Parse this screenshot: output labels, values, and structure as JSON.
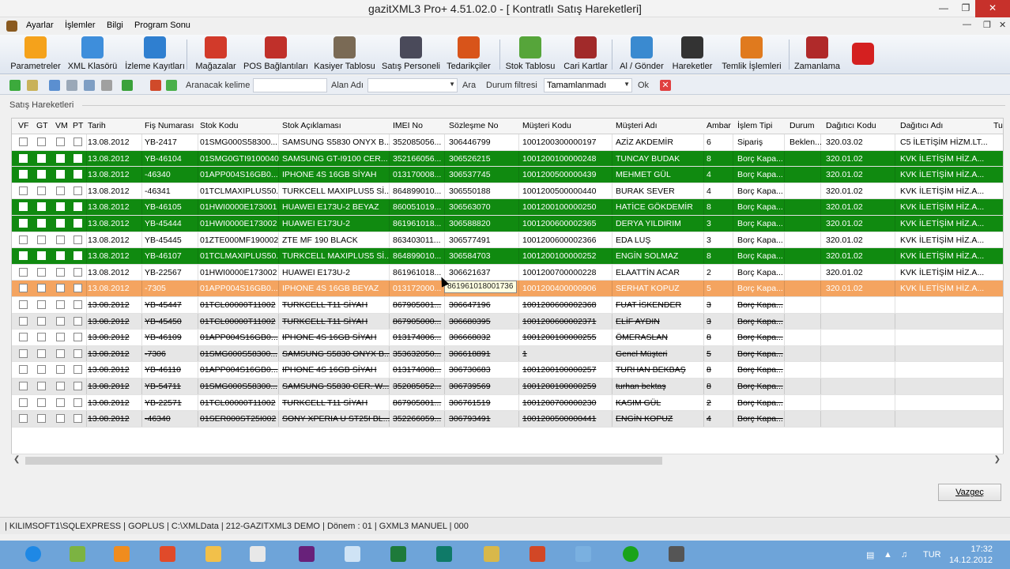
{
  "window": {
    "title": "gazitXML3 Pro+ 4.51.02.0 - [ Kontratlı Satış Hareketleri]"
  },
  "menu": [
    "Ayarlar",
    "İşlemler",
    "Bilgi",
    "Program Sonu"
  ],
  "ribbon": [
    {
      "label": "Parametreler",
      "icon": "gear-icon",
      "color": "#f5a21b"
    },
    {
      "label": "XML Klasörü",
      "icon": "folder-add-icon",
      "color": "#3e8edb"
    },
    {
      "label": "İzleme Kayıtları",
      "icon": "list-icon",
      "color": "#2f7fd0"
    },
    {
      "label": "Mağazalar",
      "icon": "store-icon",
      "color": "#d23a2a"
    },
    {
      "label": "POS Bağlantıları",
      "icon": "bank-icon",
      "color": "#c0302a"
    },
    {
      "label": "Kasiyer Tablosu",
      "icon": "cash-register-icon",
      "color": "#7a6a55"
    },
    {
      "label": "Satış Personeli",
      "icon": "people-icon",
      "color": "#4a4a5a"
    },
    {
      "label": "Tedarikçiler",
      "icon": "supplier-icon",
      "color": "#d8541a"
    },
    {
      "label": "Stok Tablosu",
      "icon": "stock-icon",
      "color": "#56a53a"
    },
    {
      "label": "Cari Kartlar",
      "icon": "cards-icon",
      "color": "#a12a2a"
    },
    {
      "label": "Al / Gönder",
      "icon": "transfer-icon",
      "color": "#3a8ad0"
    },
    {
      "label": "Hareketler",
      "icon": "movements-icon",
      "color": "#333333"
    },
    {
      "label": "Temlik İşlemleri",
      "icon": "assignment-icon",
      "color": "#e07a1e"
    },
    {
      "label": "Zamanlama",
      "icon": "schedule-icon",
      "color": "#b02a2a"
    },
    {
      "label": "",
      "icon": "power-icon",
      "color": "#d42020"
    }
  ],
  "toolbar": {
    "search_label": "Aranacak kelime",
    "search_value": "",
    "field_label": "Alan Adı",
    "field_value": "",
    "search_button": "Ara",
    "status_filter_label": "Durum filtresi",
    "status_filter_value": "Tamamlanmadı",
    "ok_button": "Ok"
  },
  "group_title": "Satış Hareketleri",
  "grid": {
    "columns": [
      "VF",
      "GT",
      "VM",
      "PT",
      "Tarih",
      "Fiş Numarası",
      "Stok Kodu",
      "Stok Açıklaması",
      "IMEI No",
      "Sözleşme No",
      "Müşteri Kodu",
      "Müşteri Adı",
      "Ambar",
      "İşlem Tipi",
      "Durum",
      "Dağıtıcı Kodu",
      "Dağıtıcı Adı",
      "Tu"
    ],
    "rows": [
      {
        "style": "white",
        "cells": [
          "13.08.2012",
          "YB-2417",
          "01SMG000S58300...",
          "SAMSUNG S5830 ONYX B...",
          "352085056...",
          "306446799",
          "1001200300000197",
          "AZİZ AKDEMİR",
          "6",
          "Sipariş",
          "Beklen...",
          "320.03.02",
          "C5 İLETİŞİM HİZM.LT..."
        ]
      },
      {
        "style": "green",
        "cells": [
          "13.08.2012",
          "YB-46104",
          "01SMG0GTI9100040",
          "SAMSUNG GT-I9100 CER...",
          "352166056...",
          "306526215",
          "1001200100000248",
          "TUNCAY BUDAK",
          "8",
          "Borç Kapa...",
          "",
          "320.01.02",
          "KVK İLETİŞİM HİZ.A..."
        ]
      },
      {
        "style": "green",
        "cells": [
          "13.08.2012",
          "-46340",
          "01APP004S16GB0...",
          "IPHONE 4S 16GB SİYAH",
          "013170008...",
          "306537745",
          "1001200500000439",
          "MEHMET GÜL",
          "4",
          "Borç Kapa...",
          "",
          "320.01.02",
          "KVK İLETİŞİM HİZ.A..."
        ]
      },
      {
        "style": "white",
        "cells": [
          "13.08.2012",
          "-46341",
          "01TCLMAXIPLUS50...",
          "TURKCELL MAXIPLUS5 Sİ...",
          "864899010...",
          "306550188",
          "1001200500000440",
          "BURAK SEVER",
          "4",
          "Borç Kapa...",
          "",
          "320.01.02",
          "KVK İLETİŞİM HİZ.A..."
        ]
      },
      {
        "style": "green",
        "cells": [
          "13.08.2012",
          "YB-46105",
          "01HWI0000E173001",
          "HUAWEI E173U-2 BEYAZ",
          "860051019...",
          "306563070",
          "1001200100000250",
          "HATİCE GÖKDEMİR",
          "8",
          "Borç Kapa...",
          "",
          "320.01.02",
          "KVK İLETİŞİM HİZ.A..."
        ]
      },
      {
        "style": "green",
        "cells": [
          "13.08.2012",
          "YB-45444",
          "01HWI0000E173002",
          "HUAWEI E173U-2",
          "861961018...",
          "306588820",
          "1001200600002365",
          "DERYA YILDIRIM",
          "3",
          "Borç Kapa...",
          "",
          "320.01.02",
          "KVK İLETİŞİM HİZ.A..."
        ]
      },
      {
        "style": "white",
        "cells": [
          "13.08.2012",
          "YB-45445",
          "01ZTE000MF190002",
          "ZTE MF 190 BLACK",
          "863403011...",
          "306577491",
          "1001200600002366",
          "EDA LUŞ",
          "3",
          "Borç Kapa...",
          "",
          "320.01.02",
          "KVK İLETİŞİM HİZ.A..."
        ]
      },
      {
        "style": "green",
        "cells": [
          "13.08.2012",
          "YB-46107",
          "01TCLMAXIPLUS50...",
          "TURKCELL MAXIPLUS5 Sİ...",
          "864899010...",
          "306584703",
          "1001200100000252",
          "ENGİN SOLMAZ",
          "8",
          "Borç Kapa...",
          "",
          "320.01.02",
          "KVK İLETİŞİM HİZ.A..."
        ]
      },
      {
        "style": "white",
        "cells": [
          "13.08.2012",
          "YB-22567",
          "01HWI0000E173002",
          "HUAWEI E173U-2",
          "861961018...",
          "306621637",
          "1001200700000228",
          "ELAATTİN ACAR",
          "2",
          "Borç Kapa...",
          "",
          "320.01.02",
          "KVK İLETİŞİM HİZ.A..."
        ]
      },
      {
        "style": "orange",
        "cells": [
          "13.08.2012",
          "-7305",
          "01APP004S16GB0...",
          "IPHONE 4S 16GB BEYAZ",
          "013172000...",
          "",
          "1001200400000906",
          "SERHAT KOPUZ",
          "5",
          "Borç Kapa...",
          "",
          "320.01.02",
          "KVK İLETİŞİM HİZ.A..."
        ]
      },
      {
        "style": "white cancel",
        "cells": [
          "13.08.2012",
          "YB-45447",
          "01TCL00000T11002",
          "TURKCELL T11 SİYAH",
          "867905001...",
          "306647196",
          "1001200600002368",
          "FUAT İSKENDER",
          "3",
          "Borç Kapa...",
          "",
          "",
          ""
        ]
      },
      {
        "style": "gray cancel",
        "cells": [
          "13.08.2012",
          "YB-45450",
          "01TCL00000T11002",
          "TURKCELL T11 SİYAH",
          "867905000...",
          "306680395",
          "1001200600002371",
          "ELİF AYDIN",
          "3",
          "Borç Kapa...",
          "",
          "",
          ""
        ]
      },
      {
        "style": "white cancel",
        "cells": [
          "13.08.2012",
          "YB-46109",
          "01APP004S16GB0...",
          "IPHONE 4S 16GB SİYAH",
          "013174006...",
          "306668032",
          "1001200100000255",
          "ÖMERASLAN",
          "8",
          "Borç Kapa...",
          "",
          "",
          ""
        ]
      },
      {
        "style": "gray cancel",
        "cells": [
          "13.08.2012",
          "-7306",
          "01SMG000S58300...",
          "SAMSUNG S5830 ONYX B...",
          "353632050...",
          "306618891",
          "1",
          "Genel Müşteri",
          "5",
          "Borç Kapa...",
          "",
          "",
          ""
        ]
      },
      {
        "style": "white cancel",
        "cells": [
          "13.08.2012",
          "YB-46110",
          "01APP004S16GB0...",
          "IPHONE 4S 16GB SİYAH",
          "013174008...",
          "306730683",
          "1001200100000257",
          "TURHAN BEKBAŞ",
          "8",
          "Borç Kapa...",
          "",
          "",
          ""
        ]
      },
      {
        "style": "gray cancel",
        "cells": [
          "13.08.2012",
          "YB-54711",
          "01SMG000S58300...",
          "SAMSUNG S5830 CER. W...",
          "352085052...",
          "306739569",
          "1001200100000259",
          "turhan bektaş",
          "8",
          "Borç Kapa...",
          "",
          "",
          ""
        ]
      },
      {
        "style": "white cancel",
        "cells": [
          "13.08.2012",
          "YB-22571",
          "01TCL00000T11002",
          "TURKCELL T11 SİYAH",
          "867905001...",
          "306761519",
          "1001200700000230",
          "KASIM GÜL",
          "2",
          "Borç Kapa...",
          "",
          "",
          ""
        ]
      },
      {
        "style": "gray cancel",
        "cells": [
          "13.08.2012",
          "-46340",
          "01SER000ST25I002",
          "SONY XPERIA U ST25I BL...",
          "352266059...",
          "306793491",
          "1001200500000441",
          "ENGİN KOPUZ",
          "4",
          "Borç Kapa...",
          "",
          "",
          ""
        ]
      }
    ]
  },
  "tooltip": "861961018001736",
  "buttons": {
    "cancel": "Vazgeç"
  },
  "statusbar": "|  KILIMSOFT1\\SQLEXPRESS  |  GOPLUS  |  C:\\XMLData  |  212-GAZITXML3 DEMO  |  Dönem : 01  |  GXML3 MANUEL  |  000",
  "taskbar": {
    "apps": [
      {
        "icon": "ie-icon",
        "color": "#1e88e5"
      },
      {
        "icon": "people-icon",
        "color": "#7cb342"
      },
      {
        "icon": "media-player-icon",
        "color": "#f08c1e"
      },
      {
        "icon": "paint-icon",
        "color": "#e04a2a"
      },
      {
        "icon": "file-explorer-icon",
        "color": "#f2c04a"
      },
      {
        "icon": "hp-icon",
        "color": "#e8e8e8"
      },
      {
        "icon": "visual-studio-icon",
        "color": "#68217a"
      },
      {
        "icon": "notes-icon",
        "color": "#cfe3f5"
      },
      {
        "icon": "excel-icon",
        "color": "#1e7a3a"
      },
      {
        "icon": "publisher-icon",
        "color": "#0f7a68"
      },
      {
        "icon": "tools-icon",
        "color": "#d8b84a"
      },
      {
        "icon": "powerpoint-icon",
        "color": "#d24726"
      },
      {
        "icon": "settings-icon",
        "color": "#7ab0e0"
      },
      {
        "icon": "green-orb-icon",
        "color": "#1aa31a"
      },
      {
        "icon": "window-icon",
        "color": "#555555"
      }
    ],
    "language": "TUR",
    "time": "17:32",
    "date": "14.12.2012"
  }
}
